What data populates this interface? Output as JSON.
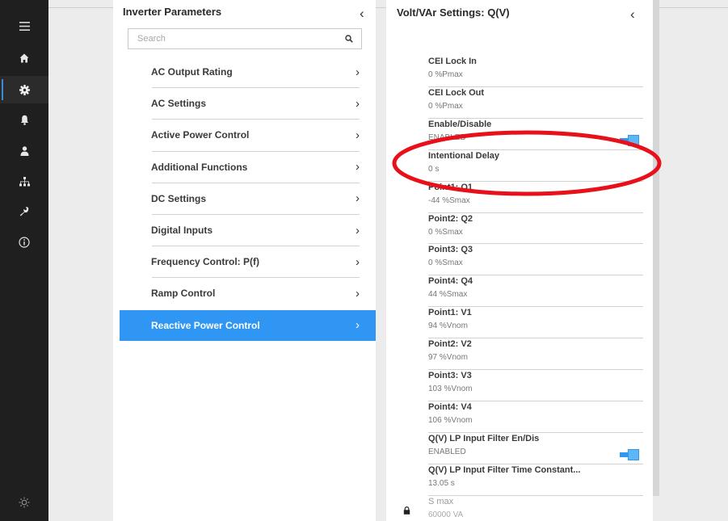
{
  "rail": {
    "icons": [
      "menu-icon",
      "home-icon",
      "gear-icon",
      "bell-icon",
      "user-icon",
      "network-icon",
      "wrench-icon",
      "info-icon",
      "sun-icon"
    ]
  },
  "inverter_panel": {
    "title": "Inverter Parameters",
    "search": {
      "placeholder": "Search"
    },
    "items": [
      {
        "label": "AC Output Rating",
        "selected": false
      },
      {
        "label": "AC Settings",
        "selected": false
      },
      {
        "label": "Active Power Control",
        "selected": false
      },
      {
        "label": "Additional Functions",
        "selected": false
      },
      {
        "label": "DC Settings",
        "selected": false
      },
      {
        "label": "Digital Inputs",
        "selected": false
      },
      {
        "label": "Frequency Control: P(f)",
        "selected": false
      },
      {
        "label": "Ramp Control",
        "selected": false
      },
      {
        "label": "Reactive Power Control",
        "selected": true
      }
    ]
  },
  "settings_panel": {
    "title": "Volt/VAr Settings: Q(V)",
    "items": [
      {
        "name": "CEI Lock In",
        "value": "0 %Pmax"
      },
      {
        "name": "CEI Lock Out",
        "value": "0 %Pmax"
      },
      {
        "name": "Enable/Disable",
        "value": "ENABLED",
        "toggle": true
      },
      {
        "name": "Intentional Delay",
        "value": "0 s"
      },
      {
        "name": "Point1: Q1",
        "value": "-44 %Smax"
      },
      {
        "name": "Point2: Q2",
        "value": "0 %Smax"
      },
      {
        "name": "Point3: Q3",
        "value": "0 %Smax"
      },
      {
        "name": "Point4: Q4",
        "value": "44 %Smax"
      },
      {
        "name": "Point1: V1",
        "value": "94 %Vnom"
      },
      {
        "name": "Point2: V2",
        "value": "97 %Vnom"
      },
      {
        "name": "Point3: V3",
        "value": "103 %Vnom"
      },
      {
        "name": "Point4: V4",
        "value": "106 %Vnom"
      },
      {
        "name": "Q(V) LP Input Filter En/Dis",
        "value": "ENABLED",
        "toggle": true
      },
      {
        "name": "Q(V) LP Input Filter Time Constant...",
        "value": "13.05 s"
      },
      {
        "name": "S max",
        "value": "60000 VA",
        "locked": true
      }
    ]
  },
  "colors": {
    "accent": "#2f97f3",
    "rail": "#1f1f1f",
    "annotation": "#e8101a"
  }
}
